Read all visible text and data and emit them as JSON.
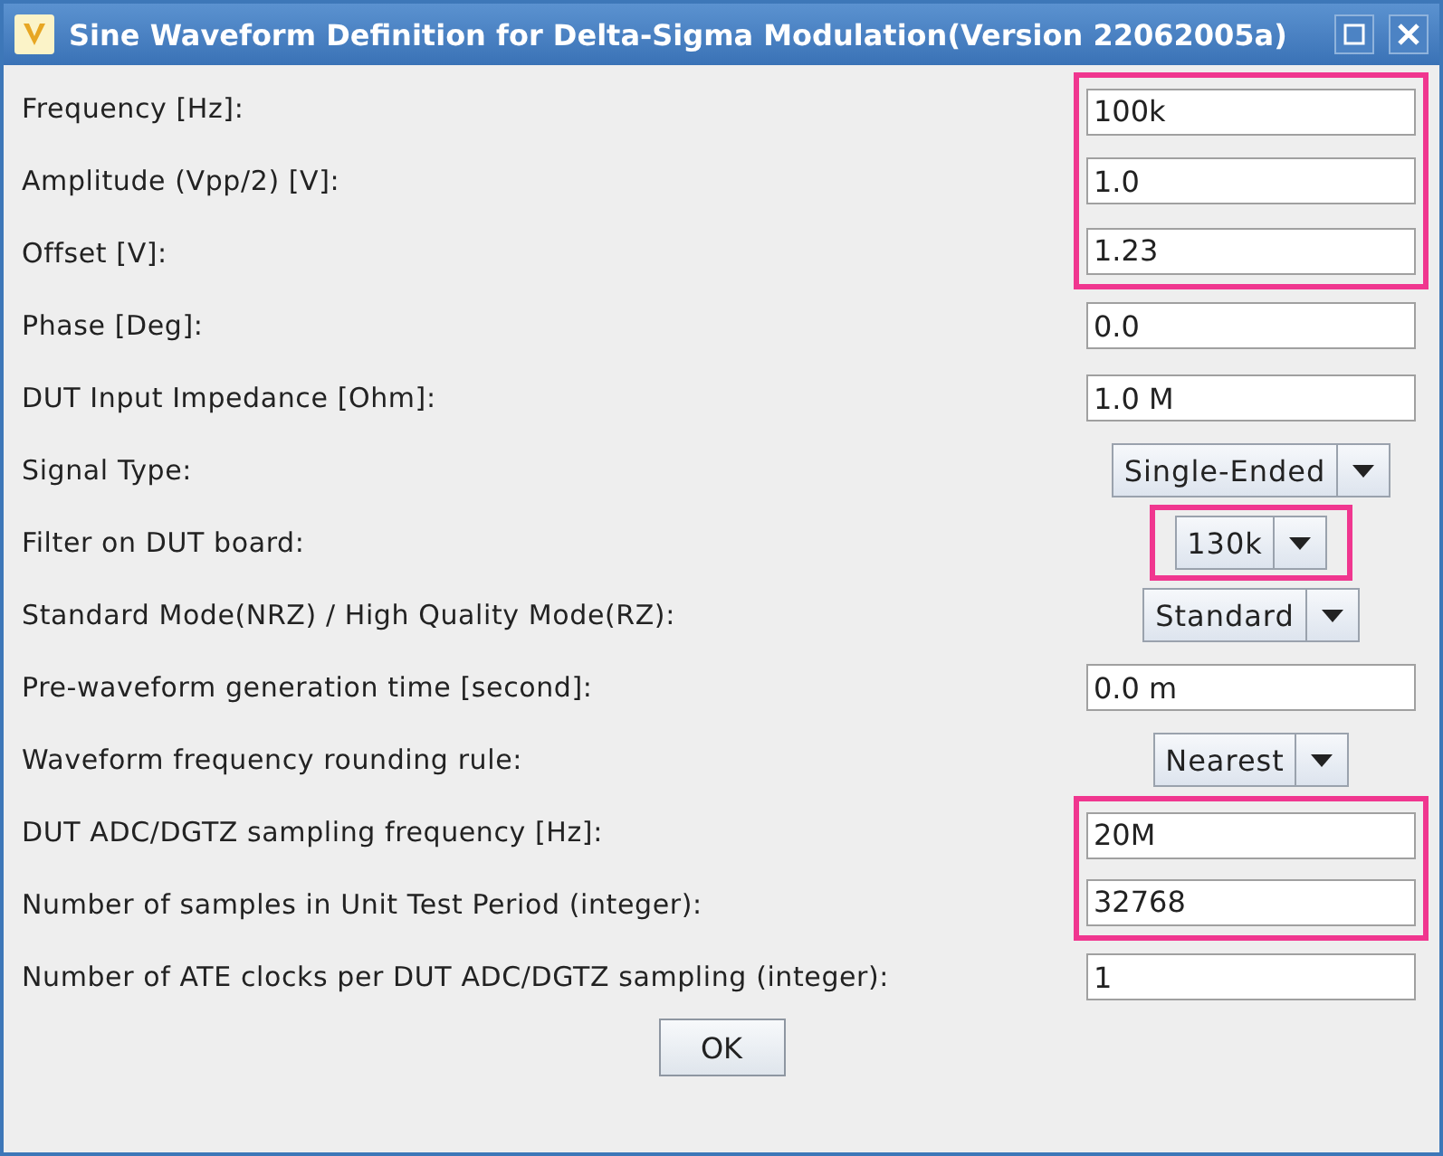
{
  "window": {
    "title": "Sine Waveform Definition for Delta-Sigma Modulation(Version 22062005a)"
  },
  "rows": [
    {
      "label": "Frequency [Hz]:",
      "kind": "text",
      "value": "100k",
      "highlighted": true
    },
    {
      "label": "Amplitude (Vpp/2) [V]:",
      "kind": "text",
      "value": "1.0",
      "highlighted": true
    },
    {
      "label": "Offset [V]:",
      "kind": "text",
      "value": "1.23",
      "highlighted": true
    },
    {
      "label": "Phase [Deg]:",
      "kind": "text",
      "value": "0.0",
      "highlighted": false
    },
    {
      "label": "DUT Input Impedance [Ohm]:",
      "kind": "text",
      "value": "1.0 M",
      "highlighted": false
    },
    {
      "label": "Signal Type:",
      "kind": "combo",
      "value": "Single-Ended",
      "highlighted": false
    },
    {
      "label": "Filter on DUT board:",
      "kind": "combo",
      "value": "130k",
      "highlighted": true
    },
    {
      "label": "Standard Mode(NRZ) / High Quality Mode(RZ):",
      "kind": "combo",
      "value": "Standard",
      "highlighted": false
    },
    {
      "label": "Pre-waveform generation time [second]:",
      "kind": "text",
      "value": "0.0 m",
      "highlighted": false
    },
    {
      "label": "Waveform frequency rounding rule:",
      "kind": "combo",
      "value": "Nearest",
      "highlighted": false
    },
    {
      "label": "DUT ADC/DGTZ sampling frequency [Hz]:",
      "kind": "text",
      "value": "20M",
      "highlighted": true
    },
    {
      "label": "Number of samples in Unit Test Period (integer):",
      "kind": "text",
      "value": "32768",
      "highlighted": true
    },
    {
      "label": "Number of ATE clocks per DUT ADC/DGTZ sampling (integer):",
      "kind": "text",
      "value": "1",
      "highlighted": false
    }
  ],
  "buttons": [
    "OK"
  ]
}
